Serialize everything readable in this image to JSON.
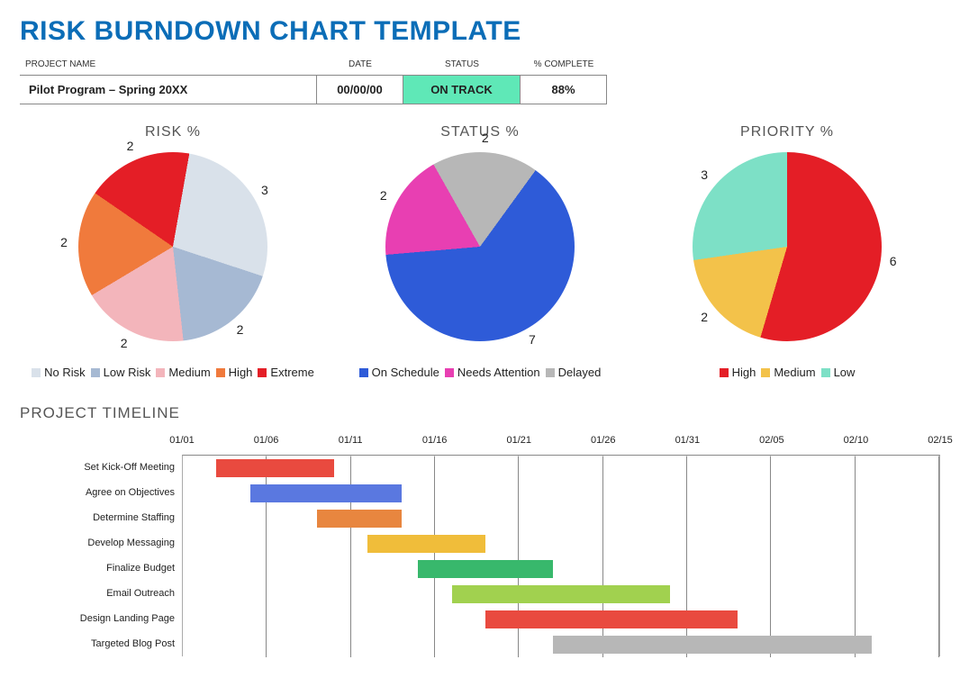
{
  "title": "RISK BURNDOWN CHART TEMPLATE",
  "header": {
    "columns": {
      "project_name": "PROJECT NAME",
      "date": "DATE",
      "status": "STATUS",
      "complete": "% COMPLETE"
    },
    "values": {
      "project_name": "Pilot Program – Spring 20XX",
      "date": "00/00/00",
      "status": "ON TRACK",
      "complete": "88%"
    }
  },
  "charts": {
    "risk": {
      "title": "RISK %",
      "legend": [
        {
          "label": "No Risk",
          "color": "#d9e1ea"
        },
        {
          "label": "Low Risk",
          "color": "#a6b9d3"
        },
        {
          "label": "Medium",
          "color": "#f3b5bb"
        },
        {
          "label": "High",
          "color": "#f07a3c"
        },
        {
          "label": "Extreme",
          "color": "#e41e26"
        }
      ]
    },
    "status": {
      "title": "STATUS %",
      "legend": [
        {
          "label": "On Schedule",
          "color": "#2e5bd8"
        },
        {
          "label": "Needs Attention",
          "color": "#e83fb2"
        },
        {
          "label": "Delayed",
          "color": "#b7b7b7"
        }
      ]
    },
    "priority": {
      "title": "PRIORITY %",
      "legend": [
        {
          "label": "High",
          "color": "#e41e26"
        },
        {
          "label": "Medium",
          "color": "#f3c24a"
        },
        {
          "label": "Low",
          "color": "#7de0c6"
        }
      ]
    }
  },
  "chart_data": [
    {
      "type": "pie",
      "title": "RISK %",
      "series": [
        {
          "name": "No Risk",
          "value": 3,
          "color": "#d9e1ea"
        },
        {
          "name": "Low Risk",
          "value": 2,
          "color": "#a6b9d3"
        },
        {
          "name": "Medium",
          "value": 2,
          "color": "#f3b5bb"
        },
        {
          "name": "High",
          "value": 2,
          "color": "#f07a3c"
        },
        {
          "name": "Extreme",
          "value": 2,
          "color": "#e41e26"
        }
      ]
    },
    {
      "type": "pie",
      "title": "STATUS %",
      "series": [
        {
          "name": "On Schedule",
          "value": 7,
          "color": "#2e5bd8"
        },
        {
          "name": "Needs Attention",
          "value": 2,
          "color": "#e83fb2"
        },
        {
          "name": "Delayed",
          "value": 2,
          "color": "#b7b7b7"
        }
      ]
    },
    {
      "type": "pie",
      "title": "PRIORITY %",
      "series": [
        {
          "name": "High",
          "value": 6,
          "color": "#e41e26"
        },
        {
          "name": "Medium",
          "value": 2,
          "color": "#f3c24a"
        },
        {
          "name": "Low",
          "value": 3,
          "color": "#7de0c6"
        }
      ]
    },
    {
      "type": "bar",
      "title": "PROJECT TIMELINE",
      "xlabel": "",
      "ylabel": "",
      "x_ticks": [
        "01/01",
        "01/06",
        "01/11",
        "01/16",
        "01/21",
        "01/26",
        "01/31",
        "02/05",
        "02/10",
        "02/15"
      ],
      "x_range_days": 45,
      "tasks": [
        {
          "name": "Set Kick-Off Meeting",
          "start": 2,
          "end": 9,
          "color": "#e94a3f"
        },
        {
          "name": "Agree on Objectives",
          "start": 4,
          "end": 13,
          "color": "#5a78e0"
        },
        {
          "name": "Determine Staffing",
          "start": 8,
          "end": 13,
          "color": "#e8863f"
        },
        {
          "name": "Develop Messaging",
          "start": 11,
          "end": 18,
          "color": "#f0bd3a"
        },
        {
          "name": "Finalize Budget",
          "start": 14,
          "end": 22,
          "color": "#38b86c"
        },
        {
          "name": "Email Outreach",
          "start": 16,
          "end": 29,
          "color": "#a1d14f"
        },
        {
          "name": "Design Landing Page",
          "start": 18,
          "end": 33,
          "color": "#e94a3f"
        },
        {
          "name": "Targeted Blog Post",
          "start": 22,
          "end": 41,
          "color": "#b7b7b7"
        }
      ]
    }
  ],
  "timeline_title": "PROJECT TIMELINE"
}
